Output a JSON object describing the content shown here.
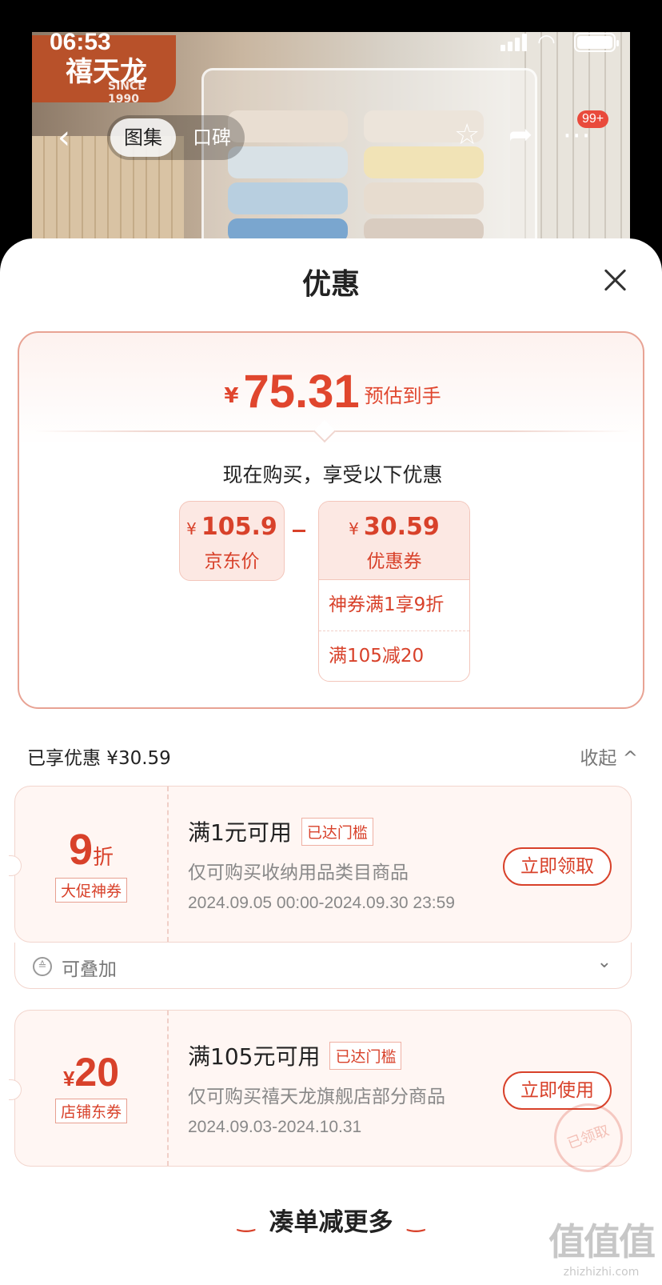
{
  "status_bar": {
    "time": "06:53"
  },
  "brand": {
    "logo_text": "禧天龙",
    "since": "SINCE 1990"
  },
  "nav": {
    "tab_gallery": "图集",
    "tab_reviews": "口碑",
    "more_badge": "99+"
  },
  "sheet": {
    "title": "优惠"
  },
  "summary": {
    "currency": "¥",
    "final_price": "75.31",
    "final_label": "预估到手",
    "buy_now_text": "现在购买，享受以下优惠",
    "jd_price_value": "105.9",
    "jd_price_label": "京东价",
    "minus_sign": "-",
    "coupon_value": "30.59",
    "coupon_label": "优惠券",
    "coupon_details": [
      "神券满1享9折",
      "满105减20"
    ]
  },
  "enjoyed": {
    "label": "已享优惠 ¥30.59",
    "collapse_label": "收起"
  },
  "coupons": [
    {
      "amount": "9",
      "amount_unit": "折",
      "tag": "大促神券",
      "condition": "满1元可用",
      "reached": "已达门槛",
      "scope": "仅可购买收纳用品类目商品",
      "validity": "2024.09.05 00:00-2024.09.30 23:59",
      "button": "立即领取",
      "stack_label": "可叠加"
    },
    {
      "amount_prefix": "¥",
      "amount": "20",
      "tag": "店铺东券",
      "condition": "满105元可用",
      "reached": "已达门槛",
      "scope": "仅可购买禧天龙旗舰店部分商品",
      "validity": "2024.09.03-2024.10.31",
      "button": "立即使用",
      "stamp": "已领取"
    }
  ],
  "footer": {
    "more_label": "凑单减更多"
  },
  "watermark": {
    "big": "值值值",
    "small": "zhizhizhi.com"
  },
  "colors": {
    "accent": "#d8412a",
    "price": "#e0462e",
    "card_bg": "#fff6f3"
  }
}
